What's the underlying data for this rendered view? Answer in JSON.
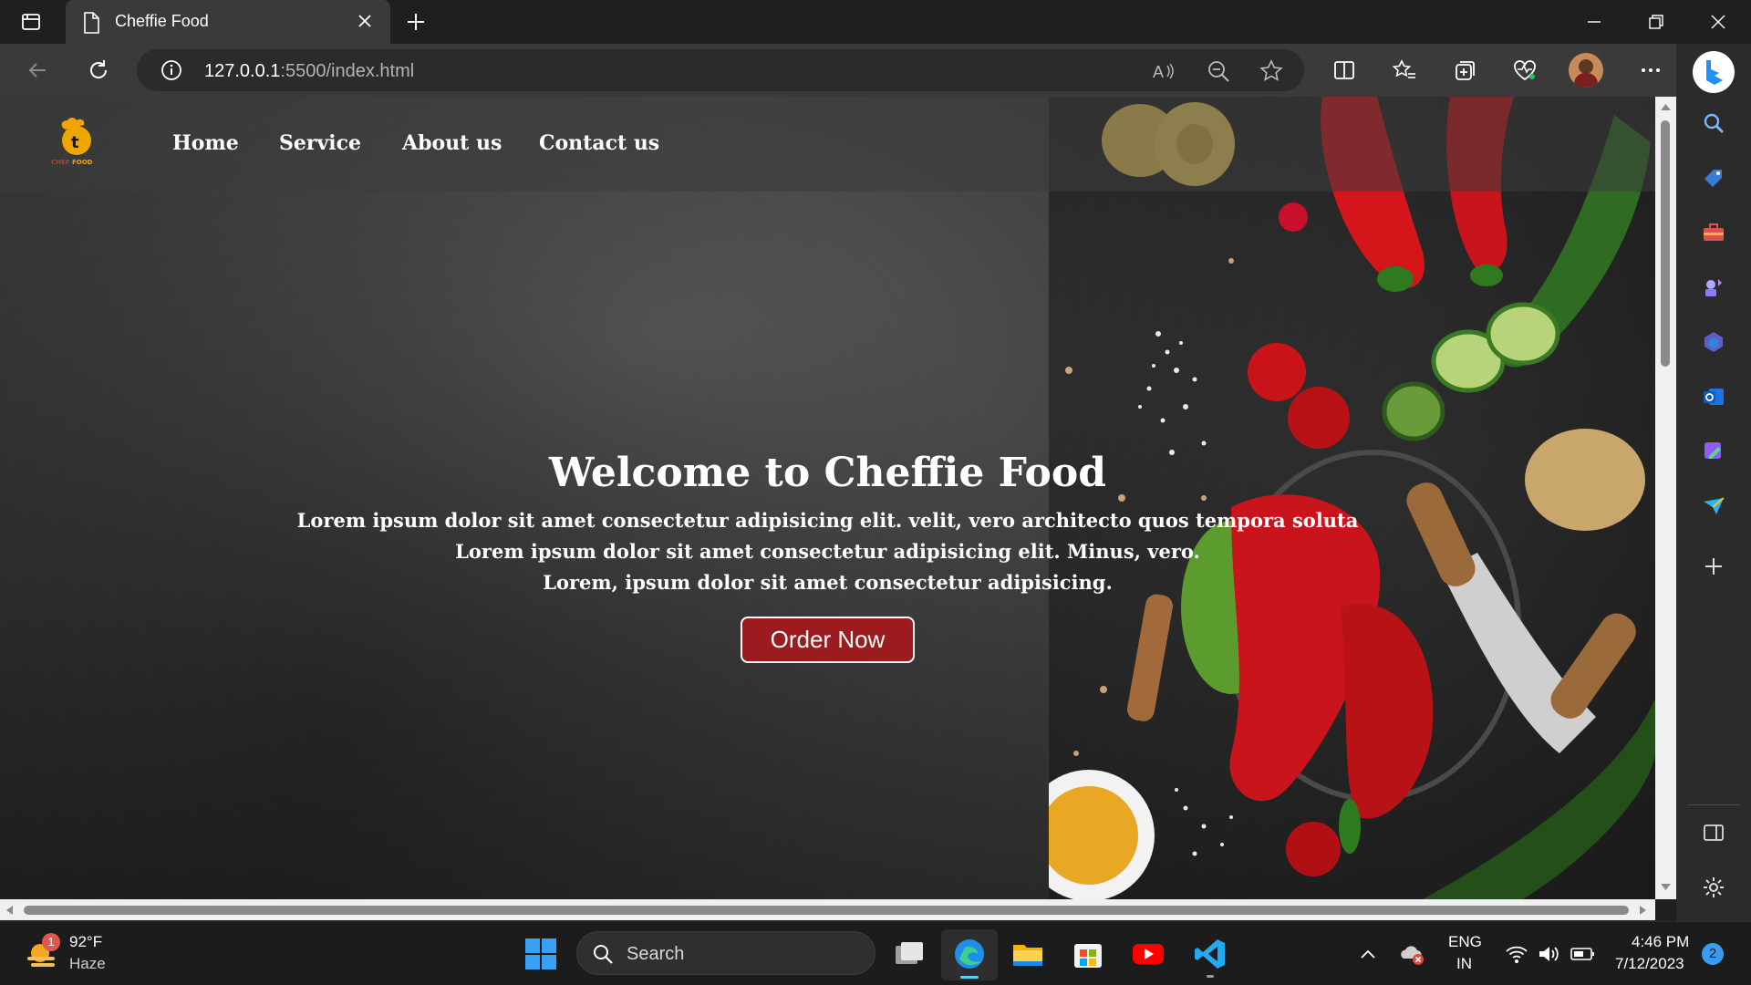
{
  "browser": {
    "tab_title": "Cheffie Food",
    "url_host": "127.0.0.1",
    "url_path": ":5500/index.html"
  },
  "site": {
    "logo_text_left": "CHEF",
    "logo_text_right": "FOOD",
    "nav": [
      "Home",
      "Service",
      "About us",
      "Contact us"
    ],
    "hero_title": "Welcome to Cheffie Food",
    "hero_lines": [
      "Lorem ipsum dolor sit amet consectetur adipisicing elit. velit, vero architecto quos tempora soluta",
      "Lorem ipsum dolor sit amet consectetur adipisicing elit. Minus, vero.",
      "Lorem, ipsum dolor sit amet consectetur adipisicing."
    ],
    "cta_label": "Order Now"
  },
  "taskbar": {
    "weather_temp": "92°F",
    "weather_desc": "Haze",
    "weather_badge": "1",
    "search_label": "Search",
    "lang_line1": "ENG",
    "lang_line2": "IN",
    "time": "4:46 PM",
    "date": "7/12/2023",
    "notification_count": "2"
  },
  "colors": {
    "accent_button": "#9b1b1e",
    "edge_blue": "#1e90ff"
  }
}
